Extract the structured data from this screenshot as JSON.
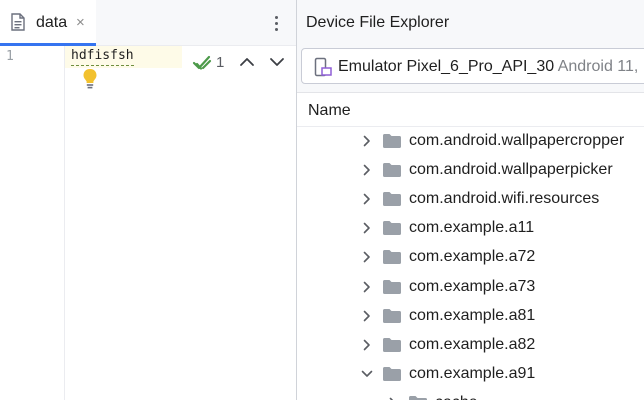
{
  "editor": {
    "tab_label": "data",
    "tab_close": "×",
    "line_number": "1",
    "code_line": "hdfisfsh",
    "inspection_count": "1"
  },
  "explorer": {
    "title": "Device File Explorer",
    "device_name": "Emulator Pixel_6_Pro_API_30",
    "device_version": "Android 11,",
    "column_name": "Name",
    "rows": [
      {
        "label": "com.android.wallpapercropper",
        "expanded": false
      },
      {
        "label": "com.android.wallpaperpicker",
        "expanded": false
      },
      {
        "label": "com.android.wifi.resources",
        "expanded": false
      },
      {
        "label": "com.example.a11",
        "expanded": false
      },
      {
        "label": "com.example.a72",
        "expanded": false
      },
      {
        "label": "com.example.a73",
        "expanded": false
      },
      {
        "label": "com.example.a81",
        "expanded": false
      },
      {
        "label": "com.example.a82",
        "expanded": false
      },
      {
        "label": "com.example.a91",
        "expanded": true
      },
      {
        "label": "cache",
        "expanded": false
      }
    ]
  },
  "colors": {
    "accent": "#3574f0",
    "folder": "#9aa0a8",
    "inspection_ok": "#4d9a4a",
    "bulb": "#f2c12e"
  }
}
